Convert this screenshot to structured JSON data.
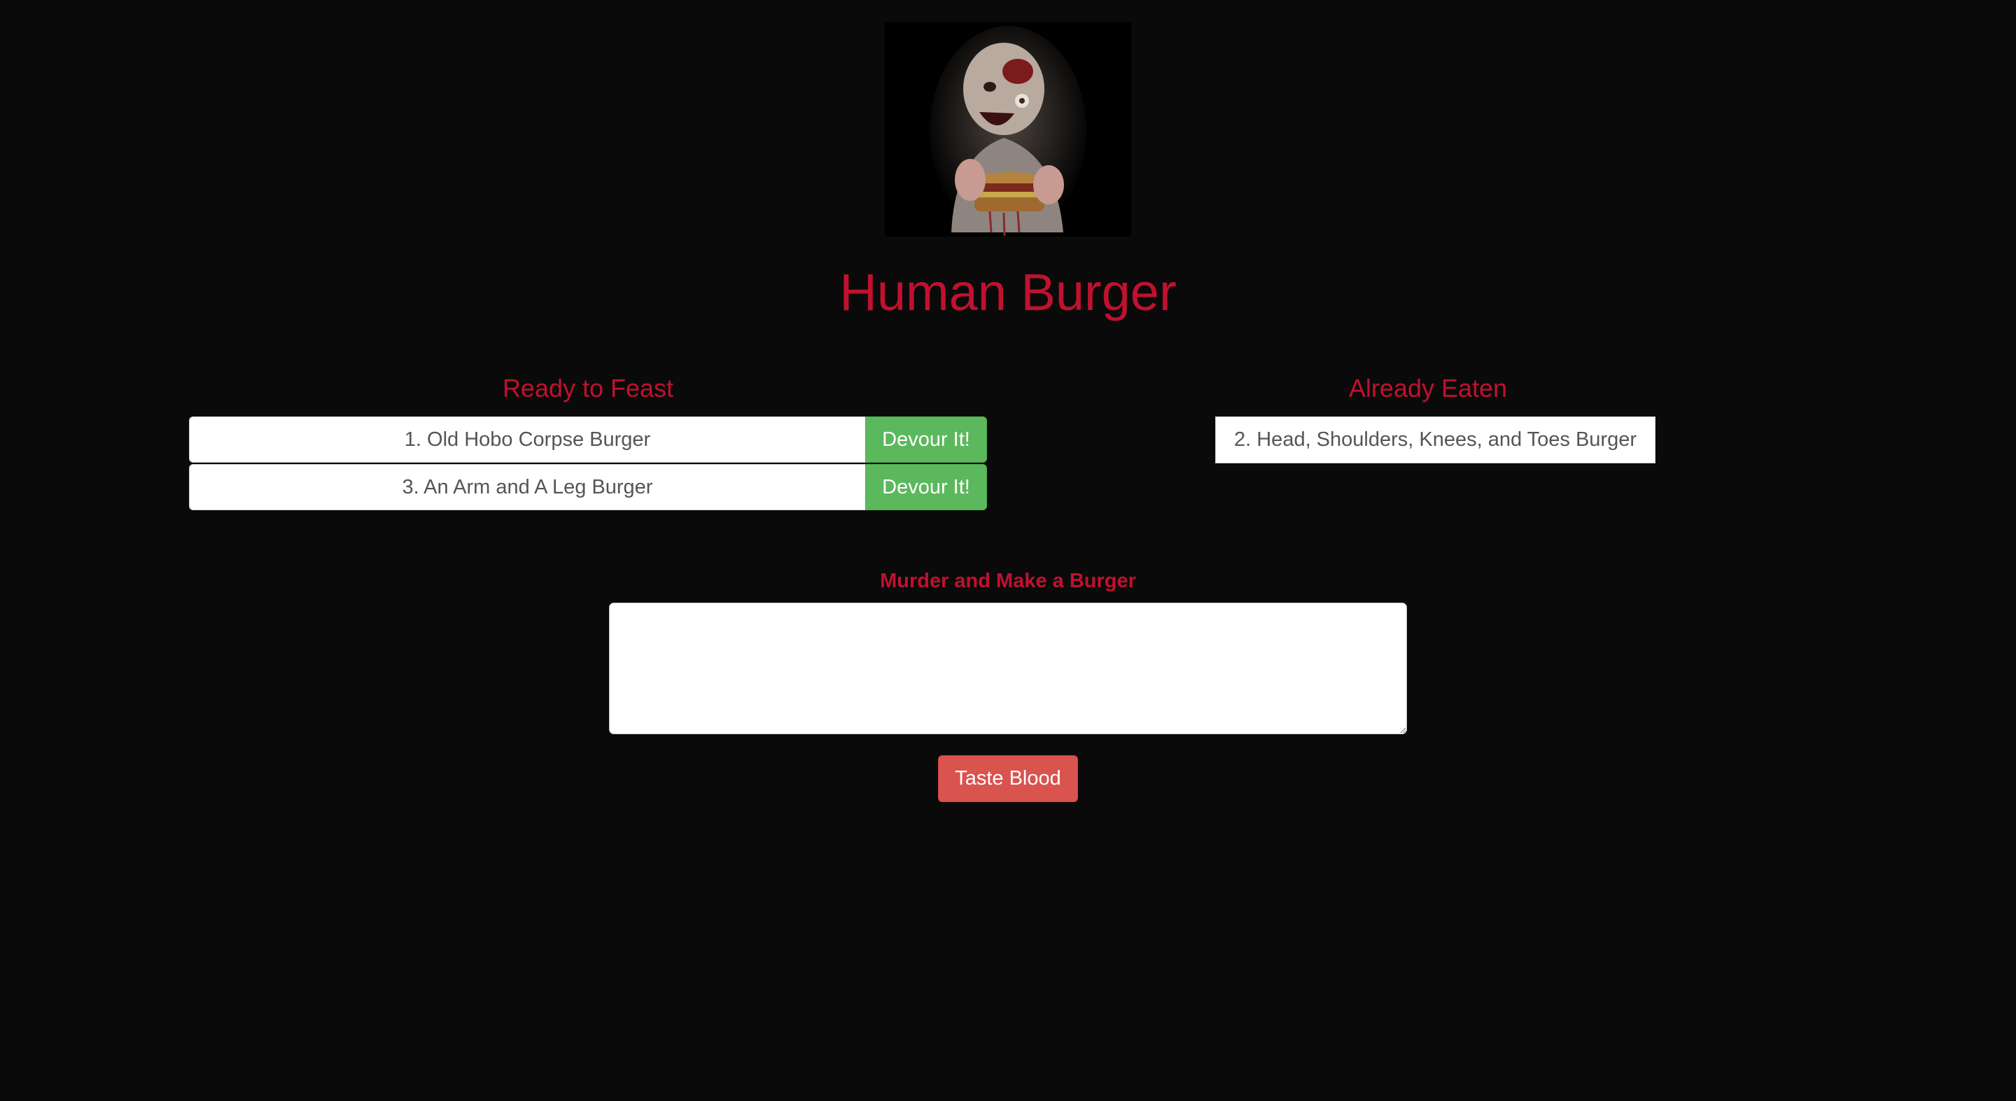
{
  "header": {
    "title": "Human Burger"
  },
  "ready": {
    "heading": "Ready to Feast",
    "items": [
      {
        "label": "1. Old Hobo Corpse Burger",
        "button": "Devour It!"
      },
      {
        "label": "3. An Arm and A Leg Burger",
        "button": "Devour It!"
      }
    ]
  },
  "eaten": {
    "heading": "Already Eaten",
    "items": [
      {
        "label": "2. Head, Shoulders, Knees, and Toes Burger"
      }
    ]
  },
  "form": {
    "label": "Murder and Make a Burger",
    "value": "",
    "submit_label": "Taste Blood"
  },
  "colors": {
    "background": "#0a0a0a",
    "accent": "#c0112f",
    "success": "#5cb85c",
    "danger": "#d9534f"
  }
}
